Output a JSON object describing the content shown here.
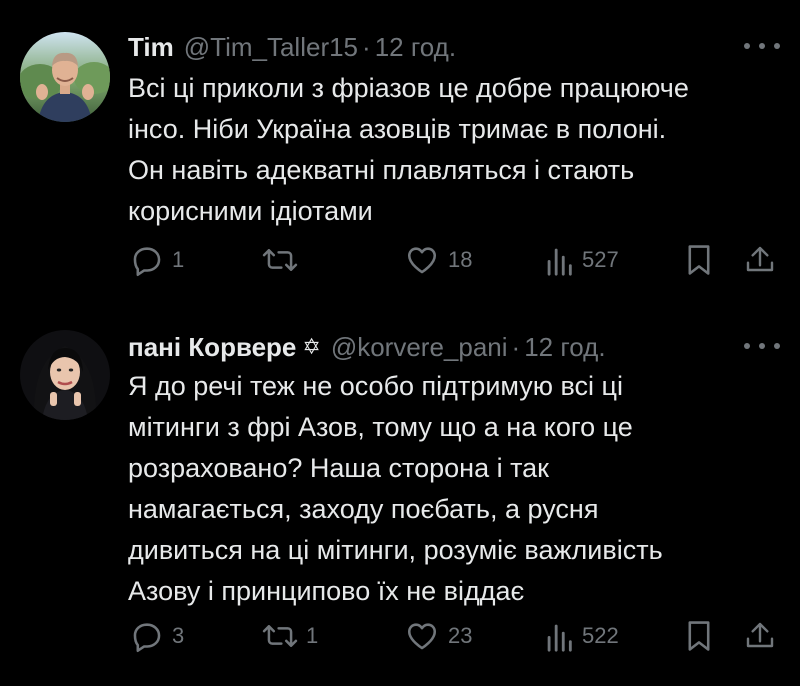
{
  "colors": {
    "background": "#000000",
    "text": "#e7e9ea",
    "secondary": "#71767b"
  },
  "tweets": [
    {
      "name": "Tim",
      "handle": "@Tim_Taller15",
      "separator": "·",
      "time": "12 год.",
      "lines": [
        "Всі ці приколи з фріазов це добре працююче",
        "інсо. Ніби Україна азовців тримає в полоні.",
        "Он навіть адекватні плавляться і стають",
        "корисними ідіотами"
      ],
      "stats": {
        "replies": "1",
        "reposts": "",
        "likes": "18",
        "views": "527"
      }
    },
    {
      "name": "пані Корвере",
      "badge": "✡",
      "handle": "@korvere_pani",
      "separator": "·",
      "time": "12 год.",
      "lines": [
        "Я до речі теж не особо підтримую всі ці",
        "мітинги з фрі Азов, тому що а на кого це",
        "розраховано? Наша сторона і так",
        "намагається, заходу поєбать, а русня",
        "дивиться на ці мітинги, розуміє важливість",
        "Азову і принципово їх не віддає"
      ],
      "stats": {
        "replies": "3",
        "reposts": "1",
        "likes": "23",
        "views": "522"
      }
    }
  ],
  "icons": {
    "reply": "reply-icon",
    "repost": "repost-icon",
    "like": "heart-icon",
    "views": "views-icon",
    "bookmark": "bookmark-icon",
    "share": "share-icon",
    "more": "more-icon"
  }
}
